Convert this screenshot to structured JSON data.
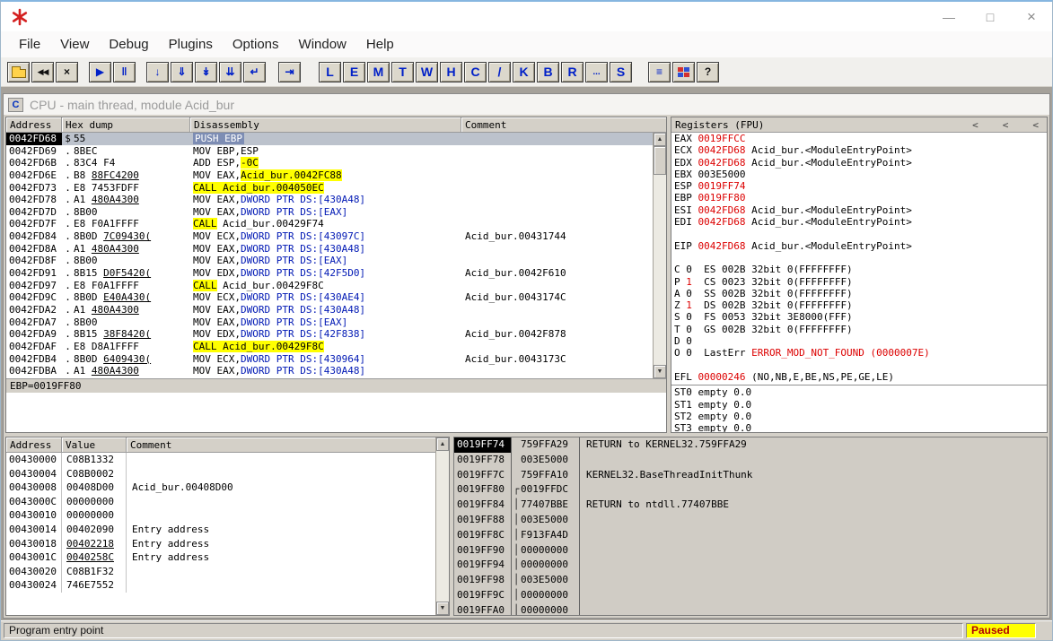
{
  "window": {
    "controls": [
      {
        "name": "minimize-button",
        "glyph": "—"
      },
      {
        "name": "maximize-button",
        "glyph": "□"
      },
      {
        "name": "close-button",
        "glyph": "×"
      }
    ]
  },
  "colors": {
    "highlight": "#ffff00",
    "changed_register": "#dc0000",
    "memory_operand": "#0018b4",
    "paused_badge_bg": "#ffff00",
    "paused_badge_text": "#b00000"
  },
  "icons": {
    "scroll_up": "▲",
    "scroll_down": "▼"
  },
  "menu": {
    "items": [
      "File",
      "View",
      "Debug",
      "Plugins",
      "Options",
      "Window",
      "Help"
    ]
  },
  "toolbar": {
    "buttons": [
      {
        "name": "open-file-button",
        "kind": "folder"
      },
      {
        "name": "restart-button",
        "glyph": "◀◀",
        "cls": "dk sm"
      },
      {
        "name": "close-program-button",
        "glyph": "×",
        "cls": "dk bold"
      },
      {
        "gap": 10
      },
      {
        "name": "run-button",
        "glyph": "▶",
        "cls": "bl"
      },
      {
        "name": "pause-button",
        "glyph": "‖",
        "cls": "bl bold"
      },
      {
        "gap": 10
      },
      {
        "name": "step-into-button",
        "glyph": "↓",
        "cls": "bl bold"
      },
      {
        "name": "step-over-button",
        "glyph": "⇓",
        "cls": "bl bold"
      },
      {
        "name": "animate-into-button",
        "glyph": "↡",
        "cls": "bl bold"
      },
      {
        "name": "animate-over-button",
        "glyph": "⇊",
        "cls": "bl bold"
      },
      {
        "name": "execute-till-return-button",
        "glyph": "↵",
        "cls": "bl bold"
      },
      {
        "gap": 12
      },
      {
        "name": "go-to-button",
        "glyph": "⇥",
        "cls": "bl bold"
      },
      {
        "gap": 18
      },
      {
        "name": "view-log-button",
        "glyph": "L",
        "cls": "lt"
      },
      {
        "name": "view-executables-button",
        "glyph": "E",
        "cls": "lt"
      },
      {
        "name": "view-memory-button",
        "glyph": "M",
        "cls": "lt"
      },
      {
        "name": "view-threads-button",
        "glyph": "T",
        "cls": "lt"
      },
      {
        "name": "view-windows-button",
        "glyph": "W",
        "cls": "lt"
      },
      {
        "name": "view-handles-button",
        "glyph": "H",
        "cls": "lt"
      },
      {
        "name": "view-cpu-button",
        "glyph": "C",
        "cls": "lt"
      },
      {
        "name": "view-patches-button",
        "glyph": "/",
        "cls": "lt"
      },
      {
        "name": "view-call-stack-button",
        "glyph": "K",
        "cls": "lt"
      },
      {
        "name": "view-breakpoints-button",
        "glyph": "B",
        "cls": "lt"
      },
      {
        "name": "view-references-button",
        "glyph": "R",
        "cls": "lt"
      },
      {
        "name": "view-run-trace-button",
        "glyph": "...",
        "cls": "lt dots"
      },
      {
        "name": "view-source-button",
        "glyph": "S",
        "cls": "lt"
      },
      {
        "gap": 16
      },
      {
        "name": "windows-list-button",
        "glyph": "≡",
        "cls": "bl bold"
      },
      {
        "name": "appearance-button",
        "kind": "squares"
      },
      {
        "name": "help-button",
        "glyph": "?",
        "cls": "dk bold"
      }
    ]
  },
  "cpu": {
    "icon": "C",
    "title": "CPU - main thread, module Acid_bur"
  },
  "disasm": {
    "headers": [
      "Address",
      "Hex dump",
      "Disassembly",
      "Comment"
    ],
    "info": "EBP=0019FF80",
    "rows": [
      {
        "addr": "0042FD68",
        "op": "$",
        "sel": 1,
        "hex": [
          [
            "55",
            0
          ]
        ],
        "seg": [
          [
            "PUSH EBP",
            "sel"
          ]
        ],
        "c": ""
      },
      {
        "addr": "0042FD69",
        "op": ".",
        "hex": [
          [
            "8BEC",
            0
          ]
        ],
        "seg": [
          [
            "MOV EBP,ESP",
            "n"
          ]
        ],
        "c": ""
      },
      {
        "addr": "0042FD6B",
        "op": ".",
        "hex": [
          [
            "83C4 F4",
            0
          ]
        ],
        "seg": [
          [
            "ADD ESP,",
            "n"
          ],
          [
            "-0C",
            "y"
          ]
        ],
        "c": ""
      },
      {
        "addr": "0042FD6E",
        "op": ".",
        "hex": [
          [
            "B8 ",
            0
          ],
          [
            "88FC4200",
            1
          ]
        ],
        "seg": [
          [
            "MOV EAX,",
            "n"
          ],
          [
            "Acid_bur.0042FC88",
            "y"
          ]
        ],
        "c": ""
      },
      {
        "addr": "0042FD73",
        "op": ".",
        "hex": [
          [
            "E8 7453FDFF",
            0
          ]
        ],
        "seg": [
          [
            "CALL Acid_bur.004050EC",
            "y"
          ]
        ],
        "c": ""
      },
      {
        "addr": "0042FD78",
        "op": ".",
        "hex": [
          [
            "A1 ",
            0
          ],
          [
            "480A4300",
            1
          ]
        ],
        "seg": [
          [
            "MOV EAX,",
            "n"
          ],
          [
            "DWORD PTR DS:[430A48]",
            "b"
          ]
        ],
        "c": ""
      },
      {
        "addr": "0042FD7D",
        "op": ".",
        "hex": [
          [
            "8B00",
            0
          ]
        ],
        "seg": [
          [
            "MOV EAX,",
            "n"
          ],
          [
            "DWORD PTR DS:[EAX]",
            "b"
          ]
        ],
        "c": ""
      },
      {
        "addr": "0042FD7F",
        "op": ".",
        "hex": [
          [
            "E8 F0A1FFFF",
            0
          ]
        ],
        "seg": [
          [
            "CALL",
            "y"
          ],
          [
            " Acid_bur.00429F74",
            "n"
          ]
        ],
        "c": ""
      },
      {
        "addr": "0042FD84",
        "op": ".",
        "hex": [
          [
            "8B0D ",
            0
          ],
          [
            "7C09430(",
            1
          ]
        ],
        "seg": [
          [
            "MOV ECX,",
            "n"
          ],
          [
            "DWORD PTR DS:[43097C]",
            "b"
          ]
        ],
        "c": "Acid_bur.00431744"
      },
      {
        "addr": "0042FD8A",
        "op": ".",
        "hex": [
          [
            "A1 ",
            0
          ],
          [
            "480A4300",
            1
          ]
        ],
        "seg": [
          [
            "MOV EAX,",
            "n"
          ],
          [
            "DWORD PTR DS:[430A48]",
            "b"
          ]
        ],
        "c": ""
      },
      {
        "addr": "0042FD8F",
        "op": ".",
        "hex": [
          [
            "8B00",
            0
          ]
        ],
        "seg": [
          [
            "MOV EAX,",
            "n"
          ],
          [
            "DWORD PTR DS:[EAX]",
            "b"
          ]
        ],
        "c": ""
      },
      {
        "addr": "0042FD91",
        "op": ".",
        "hex": [
          [
            "8B15 ",
            0
          ],
          [
            "D0F5420(",
            1
          ]
        ],
        "seg": [
          [
            "MOV EDX,",
            "n"
          ],
          [
            "DWORD PTR DS:[42F5D0]",
            "b"
          ]
        ],
        "c": "Acid_bur.0042F610"
      },
      {
        "addr": "0042FD97",
        "op": ".",
        "hex": [
          [
            "E8 F0A1FFFF",
            0
          ]
        ],
        "seg": [
          [
            "CALL",
            "y"
          ],
          [
            " Acid_bur.00429F8C",
            "n"
          ]
        ],
        "c": ""
      },
      {
        "addr": "0042FD9C",
        "op": ".",
        "hex": [
          [
            "8B0D ",
            0
          ],
          [
            "E40A430(",
            1
          ]
        ],
        "seg": [
          [
            "MOV ECX,",
            "n"
          ],
          [
            "DWORD PTR DS:[430AE4]",
            "b"
          ]
        ],
        "c": "Acid_bur.0043174C"
      },
      {
        "addr": "0042FDA2",
        "op": ".",
        "hex": [
          [
            "A1 ",
            0
          ],
          [
            "480A4300",
            1
          ]
        ],
        "seg": [
          [
            "MOV EAX,",
            "n"
          ],
          [
            "DWORD PTR DS:[430A48]",
            "b"
          ]
        ],
        "c": ""
      },
      {
        "addr": "0042FDA7",
        "op": ".",
        "hex": [
          [
            "8B00",
            0
          ]
        ],
        "seg": [
          [
            "MOV EAX,",
            "n"
          ],
          [
            "DWORD PTR DS:[EAX]",
            "b"
          ]
        ],
        "c": ""
      },
      {
        "addr": "0042FDA9",
        "op": ".",
        "hex": [
          [
            "8B15 ",
            0
          ],
          [
            "38F8420(",
            1
          ]
        ],
        "seg": [
          [
            "MOV EDX,",
            "n"
          ],
          [
            "DWORD PTR DS:[42F838]",
            "b"
          ]
        ],
        "c": "Acid_bur.0042F878"
      },
      {
        "addr": "0042FDAF",
        "op": ".",
        "hex": [
          [
            "E8 D8A1FFFF",
            0
          ]
        ],
        "seg": [
          [
            "CALL Acid_bur.00429F8C",
            "y"
          ]
        ],
        "c": ""
      },
      {
        "addr": "0042FDB4",
        "op": ".",
        "hex": [
          [
            "8B0D ",
            0
          ],
          [
            "6409430(",
            1
          ]
        ],
        "seg": [
          [
            "MOV ECX,",
            "n"
          ],
          [
            "DWORD PTR DS:[430964]",
            "b"
          ]
        ],
        "c": "Acid_bur.0043173C"
      },
      {
        "addr": "0042FDBA",
        "op": ".",
        "hex": [
          [
            "A1 ",
            0
          ],
          [
            "480A4300",
            1
          ]
        ],
        "seg": [
          [
            "MOV EAX,",
            "n"
          ],
          [
            "DWORD PTR DS:[430A48]",
            "b"
          ]
        ],
        "c": ""
      }
    ]
  },
  "registers": {
    "title": "Registers (FPU)",
    "header_buttons": [
      "<",
      "<",
      "<"
    ],
    "lines": [
      [
        [
          "EAX ",
          "n"
        ],
        [
          "0019FFCC",
          "r"
        ]
      ],
      [
        [
          "ECX ",
          "n"
        ],
        [
          "0042FD68",
          "r"
        ],
        [
          " Acid_bur.<ModuleEntryPoint>",
          "n"
        ]
      ],
      [
        [
          "EDX ",
          "n"
        ],
        [
          "0042FD68",
          "r"
        ],
        [
          " Acid_bur.<ModuleEntryPoint>",
          "n"
        ]
      ],
      [
        [
          "EBX ",
          "n"
        ],
        [
          "003E5000",
          "n"
        ]
      ],
      [
        [
          "ESP ",
          "n"
        ],
        [
          "0019FF74",
          "r"
        ]
      ],
      [
        [
          "EBP ",
          "n"
        ],
        [
          "0019FF80",
          "r"
        ]
      ],
      [
        [
          "ESI ",
          "n"
        ],
        [
          "0042FD68",
          "r"
        ],
        [
          " Acid_bur.<ModuleEntryPoint>",
          "n"
        ]
      ],
      [
        [
          "EDI ",
          "n"
        ],
        [
          "0042FD68",
          "r"
        ],
        [
          " Acid_bur.<ModuleEntryPoint>",
          "n"
        ]
      ],
      [],
      [
        [
          "EIP ",
          "n"
        ],
        [
          "0042FD68",
          "r"
        ],
        [
          " Acid_bur.<ModuleEntryPoint>",
          "n"
        ]
      ],
      [],
      [
        [
          "C 0  ES 002B 32bit 0(FFFFFFFF)",
          "n"
        ]
      ],
      [
        [
          "P ",
          "n"
        ],
        [
          "1",
          "r"
        ],
        [
          "  CS 0023 32bit 0(FFFFFFFF)",
          "n"
        ]
      ],
      [
        [
          "A 0  SS 002B 32bit 0(FFFFFFFF)",
          "n"
        ]
      ],
      [
        [
          "Z ",
          "n"
        ],
        [
          "1",
          "r"
        ],
        [
          "  DS 002B 32bit 0(FFFFFFFF)",
          "n"
        ]
      ],
      [
        [
          "S 0  FS 0053 32bit 3E8000(FFF)",
          "n"
        ]
      ],
      [
        [
          "T 0  GS 002B 32bit 0(FFFFFFFF)",
          "n"
        ]
      ],
      [
        [
          "D 0",
          "n"
        ]
      ],
      [
        [
          "O 0  LastErr ",
          "n"
        ],
        [
          "ERROR_MOD_NOT_FOUND (0000007E)",
          "r"
        ]
      ],
      [],
      [
        [
          "EFL ",
          "n"
        ],
        [
          "00000246",
          "r"
        ],
        [
          " (NO,NB,E,BE,NS,PE,GE,LE)",
          "n"
        ]
      ]
    ],
    "fpu": [
      [
        [
          "ST0 empty 0.0",
          "n"
        ]
      ],
      [
        [
          "ST1 empty 0.0",
          "n"
        ]
      ],
      [
        [
          "ST2 empty 0.0",
          "n"
        ]
      ],
      [
        [
          "ST3 empty 0.0",
          "n"
        ]
      ]
    ]
  },
  "dump": {
    "headers": [
      "Address",
      "Value",
      "Comment"
    ],
    "rows": [
      {
        "addr": "00430000",
        "val": "C08B1332",
        "c": ""
      },
      {
        "addr": "00430004",
        "val": "C08B0002",
        "c": ""
      },
      {
        "addr": "00430008",
        "val": "00408D00",
        "c": "Acid_bur.00408D00"
      },
      {
        "addr": "0043000C",
        "val": "00000000",
        "c": ""
      },
      {
        "addr": "00430010",
        "val": "00000000",
        "c": ""
      },
      {
        "addr": "00430014",
        "val": "00402090",
        "c": "Entry address"
      },
      {
        "addr": "00430018",
        "val": "00402218",
        "u": 1,
        "c": "Entry address"
      },
      {
        "addr": "0043001C",
        "val": "0040258C",
        "u": 1,
        "c": "Entry address"
      },
      {
        "addr": "00430020",
        "val": "C08B1F32",
        "c": ""
      },
      {
        "addr": "00430024",
        "val": "746E7552",
        "c": ""
      }
    ]
  },
  "stack": {
    "rows": [
      {
        "addr": "0019FF74",
        "sel": 1,
        "br": "",
        "val": "759FFA29",
        "c": "RETURN to KERNEL32.759FFA29"
      },
      {
        "addr": "0019FF78",
        "br": "",
        "val": "003E5000",
        "c": ""
      },
      {
        "addr": "0019FF7C",
        "br": "",
        "val": "759FFA10",
        "c": "KERNEL32.BaseThreadInitThunk"
      },
      {
        "addr": "0019FF80",
        "br": "┌",
        "val": "0019FFDC",
        "c": ""
      },
      {
        "addr": "0019FF84",
        "br": "│",
        "val": "77407BBE",
        "c": "RETURN to ntdll.77407BBE"
      },
      {
        "addr": "0019FF88",
        "br": "│",
        "val": "003E5000",
        "c": ""
      },
      {
        "addr": "0019FF8C",
        "br": "│",
        "val": "F913FA4D",
        "c": ""
      },
      {
        "addr": "0019FF90",
        "br": "│",
        "val": "00000000",
        "c": ""
      },
      {
        "addr": "0019FF94",
        "br": "│",
        "val": "00000000",
        "c": ""
      },
      {
        "addr": "0019FF98",
        "br": "│",
        "val": "003E5000",
        "c": ""
      },
      {
        "addr": "0019FF9C",
        "br": "│",
        "val": "00000000",
        "c": ""
      },
      {
        "addr": "0019FFA0",
        "br": "│",
        "val": "00000000",
        "c": ""
      }
    ]
  },
  "status": {
    "left": "Program entry point",
    "right": "Paused"
  }
}
